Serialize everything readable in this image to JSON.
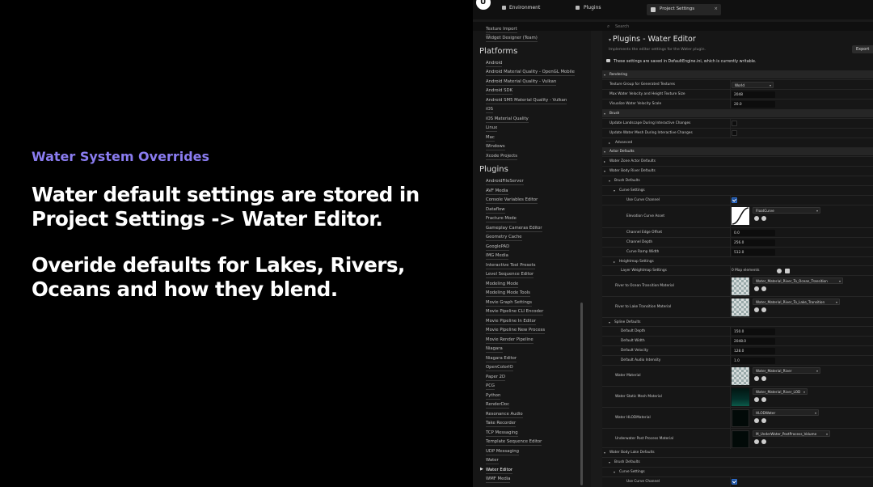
{
  "slide": {
    "eyebrow": "Water System Overrides",
    "heading1_line1": "Water default settings are stored in",
    "heading1_line2": "Project Settings -> Water Editor.",
    "heading2_line1": "Overide defaults for Lakes, Rivers,",
    "heading2_line2": "Oceans and how they blend."
  },
  "editor": {
    "top_tabs": {
      "environment": "Environment",
      "plugins": "Plugins",
      "project_settings": "Project Settings",
      "close": "×"
    },
    "search_placeholder": "Search",
    "nav": {
      "items_top": [
        "Texture Import",
        "Widget Designer (Team)"
      ],
      "platforms_title": "Platforms",
      "platforms": [
        "Android",
        "Android Material Quality - OpenGL Mobile",
        "Android Material Quality - Vulkan",
        "Android SDK",
        "Android SM5 Material Quality - Vulkan",
        "iOS",
        "iOS Material Quality",
        "Linux",
        "Mac",
        "Windows",
        "Xcode Projects"
      ],
      "plugins_title": "Plugins",
      "plugins": [
        "AndroidFileServer",
        "AVF Media",
        "Console Variables Editor",
        "Dataflow",
        "Fracture Mode",
        "Gameplay Cameras Editor",
        "Geometry Cache",
        "GooglePAD",
        "IMG Media",
        "Interactive Tool Presets",
        "Level Sequence Editor",
        "Modeling Mode",
        "Modeling Mode Tools",
        "Movie Graph Settings",
        "Movie Pipeline CLI Encoder",
        "Movie Pipeline In Editor",
        "Movie Pipeline New Process",
        "Movie Render Pipeline",
        "Niagara",
        "Niagara Editor",
        "OpenColorIO",
        "Paper 2D",
        "PCG",
        "Python",
        "RenderDoc",
        "Resonance Audio",
        "Take Recorder",
        "TCP Messaging",
        "Template Sequence Editor",
        "UDP Messaging",
        "Water",
        "Water Editor",
        "WMF Media"
      ]
    },
    "panel": {
      "title": "Plugins - Water Editor",
      "description": "Implements the editor settings for the Water plugin.",
      "export_label": "Export",
      "save_note": "These settings are saved in DefaultEngine.ini, which is currently writable."
    },
    "rows": {
      "rendering": "Rendering",
      "texture_group": "Texture Group for Generated Textures",
      "texture_group_value": "World",
      "max_velocity": "Max Water Velocity and Height Texture Size",
      "max_velocity_value": "2048",
      "vis_scale": "Visualize Water Velocity Scale",
      "vis_scale_value": "20.0",
      "brush": "Brush",
      "update_landscape": "Update Landscape During Interactive Changes",
      "update_mesh": "Update Water Mesh During Interactive Changes",
      "advanced": "Advanced",
      "actor_defaults": "Actor Defaults",
      "water_zone": "Water Zone Actor Defaults",
      "river_defaults": "Water Body River Defaults",
      "brush_defaults": "Brush Defaults",
      "curve_settings": "Curve Settings",
      "use_curve_channel": "Use Curve Channel",
      "elevation_curve": "Elevation Curve Asset",
      "elevation_curve_value": "FloatCurve",
      "channel_edge_offset": "Channel Edge Offset",
      "channel_edge_offset_value": "0.0",
      "channel_depth": "Channel Depth",
      "channel_depth_value": "256.0",
      "curve_ramp_width": "Curve Ramp Width",
      "curve_ramp_width_value": "512.0",
      "heightmap_settings": "Heightmap Settings",
      "layer_weightmap": "Layer Weightmap Settings",
      "layer_weightmap_value": "0 Map elements",
      "river_ocean": "River to Ocean Transition Material",
      "river_ocean_value": "Water_Material_River_To_Ocean_Transition",
      "river_lake": "River to Lake Transition Material",
      "river_lake_value": "Water_Material_River_To_Lake_Transition",
      "spline_defaults": "Spline Defaults",
      "default_depth": "Default Depth",
      "default_depth_value": "150.0",
      "default_width": "Default Width",
      "default_width_value": "2048.0",
      "default_velocity": "Default Velocity",
      "default_velocity_value": "128.0",
      "default_audio": "Default Audio Intensity",
      "default_audio_value": "1.0",
      "water_material": "Water Material",
      "water_material_value": "Water_Material_River",
      "static_mesh_material": "Water Static Mesh Material",
      "static_mesh_material_value": "Water_Material_River_LOD",
      "hlod_material": "Water HLODMaterial",
      "hlod_material_value": "HLODWater",
      "underwater_post": "Underwater Post Process Material",
      "underwater_post_value": "M_UnderWater_PostProcess_Volume",
      "lake_defaults": "Water Body Lake Defaults",
      "lake_brush_defaults": "Brush Defaults",
      "lake_curve_settings": "Curve Settings",
      "lake_use_curve_channel": "Use Curve Channel"
    }
  }
}
